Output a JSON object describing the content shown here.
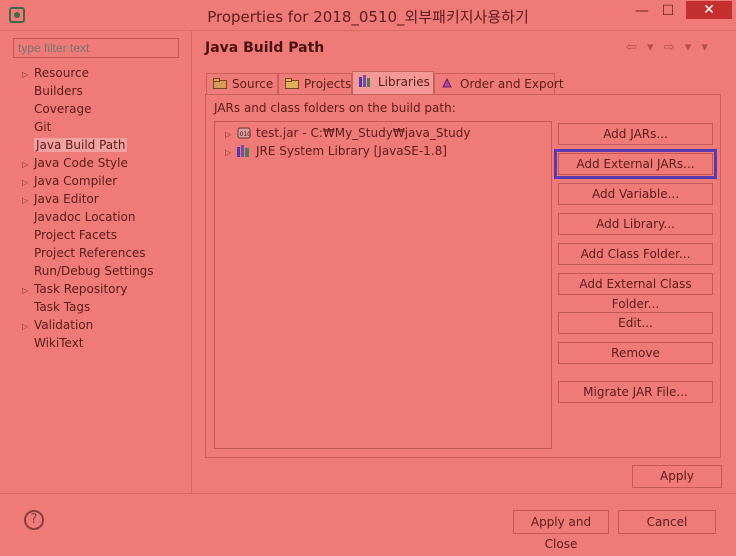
{
  "window": {
    "title": "Properties for 2018_0510_외부패키지사용하기",
    "minimize": "—",
    "maximize": "☐",
    "close": "✕"
  },
  "sidebar": {
    "filter_placeholder": "type filter text",
    "items": [
      {
        "label": "Resource",
        "expandable": true
      },
      {
        "label": "Builders",
        "expandable": false
      },
      {
        "label": "Coverage",
        "expandable": false
      },
      {
        "label": "Git",
        "expandable": false
      },
      {
        "label": "Java Build Path",
        "expandable": false,
        "selected": true
      },
      {
        "label": "Java Code Style",
        "expandable": true
      },
      {
        "label": "Java Compiler",
        "expandable": true
      },
      {
        "label": "Java Editor",
        "expandable": true
      },
      {
        "label": "Javadoc Location",
        "expandable": false
      },
      {
        "label": "Project Facets",
        "expandable": false
      },
      {
        "label": "Project References",
        "expandable": false
      },
      {
        "label": "Run/Debug Settings",
        "expandable": false
      },
      {
        "label": "Task Repository",
        "expandable": true
      },
      {
        "label": "Task Tags",
        "expandable": false
      },
      {
        "label": "Validation",
        "expandable": true
      },
      {
        "label": "WikiText",
        "expandable": false
      }
    ]
  },
  "main": {
    "title": "Java Build Path",
    "nav": "⇦ ▾ ⇨ ▾ ▾",
    "tabs": [
      {
        "label": "Source",
        "icon": "source-folder-icon"
      },
      {
        "label": "Projects",
        "icon": "projects-folder-icon"
      },
      {
        "label": "Libraries",
        "icon": "libraries-icon",
        "active": true
      },
      {
        "label": "Order and Export",
        "icon": "order-export-icon"
      }
    ],
    "panel_label": "JARs and class folders on the build path:",
    "libraries": [
      {
        "label": "test.jar - C:₩My_Study₩java_Study",
        "icon": "jar-icon"
      },
      {
        "label": "JRE System Library [JavaSE-1.8]",
        "icon": "library-icon"
      }
    ],
    "buttons": {
      "add_jars": "Add JARs...",
      "add_external_jars": "Add External JARs...",
      "add_variable": "Add Variable...",
      "add_library": "Add Library...",
      "add_class_folder": "Add Class Folder...",
      "add_external_class_folder": "Add External Class Folder...",
      "edit": "Edit...",
      "remove": "Remove",
      "migrate_jar": "Migrate JAR File..."
    },
    "apply": "Apply"
  },
  "footer": {
    "help": "?",
    "apply_and_close": "Apply and Close",
    "cancel": "Cancel"
  },
  "colors": {
    "background": "#f07a78",
    "focus_outline": "#5a3ab0",
    "close_button": "#c43030"
  }
}
